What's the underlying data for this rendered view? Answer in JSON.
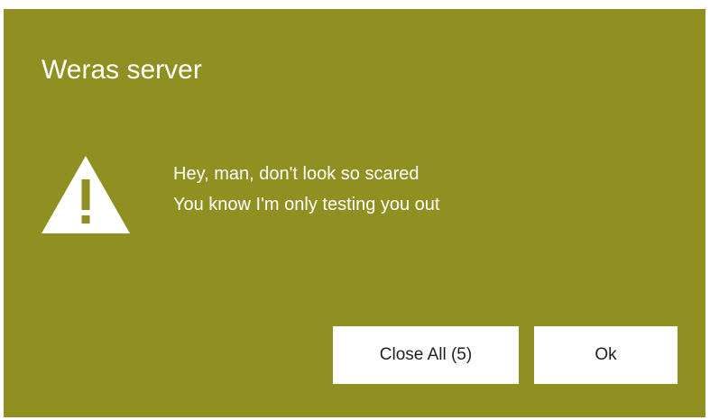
{
  "dialog": {
    "title": "Weras server",
    "icon": "warning-triangle-icon",
    "message_lines": [
      "Hey, man, don't look so scared",
      "You know I'm only testing you out"
    ],
    "buttons": {
      "close_all_label": "Close All (5)",
      "ok_label": "Ok"
    },
    "colors": {
      "background": "#8f9021",
      "text": "#ffffff",
      "button_background": "#ffffff",
      "button_text": "#1f1f1f"
    }
  }
}
